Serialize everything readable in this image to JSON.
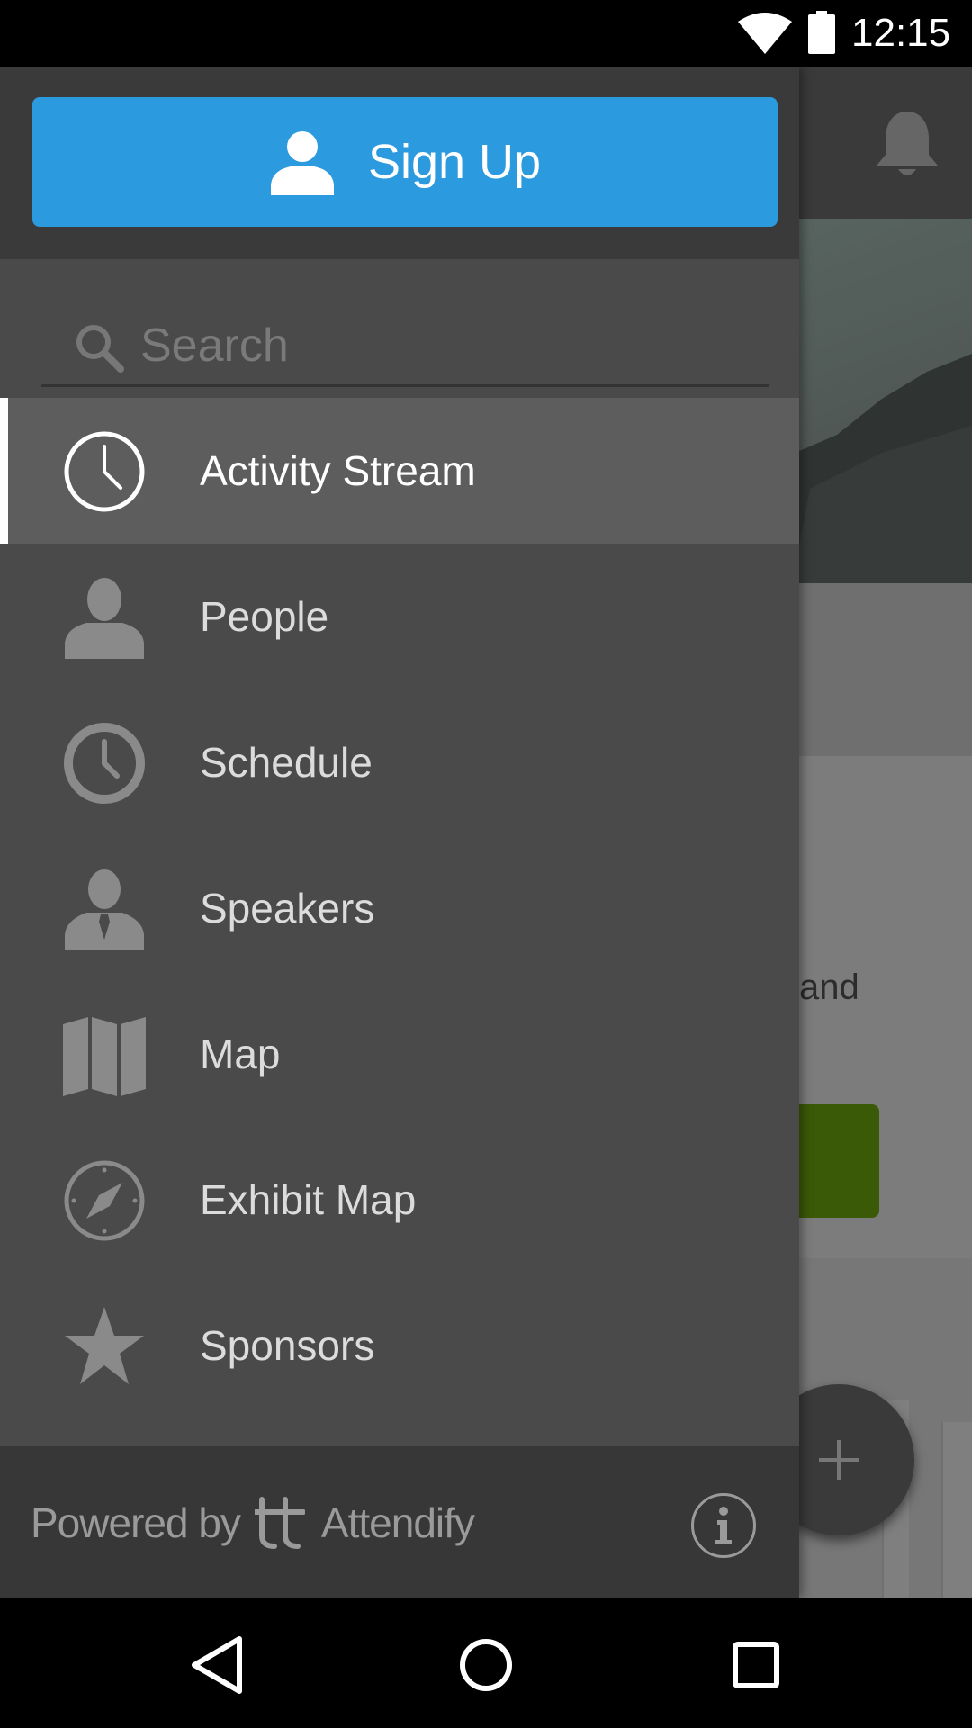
{
  "status_bar": {
    "time": "12:15",
    "icons": [
      "wifi-icon",
      "battery-icon"
    ]
  },
  "drawer": {
    "signup": {
      "label": "Sign Up",
      "icon": "user-icon"
    },
    "search": {
      "placeholder": "Search",
      "value": ""
    },
    "items": [
      {
        "label": "Activity Stream",
        "icon": "clock-outline-icon",
        "active": true
      },
      {
        "label": "People",
        "icon": "person-icon",
        "active": false
      },
      {
        "label": "Schedule",
        "icon": "clock-icon",
        "active": false
      },
      {
        "label": "Speakers",
        "icon": "speaker-person-icon",
        "active": false
      },
      {
        "label": "Map",
        "icon": "map-icon",
        "active": false
      },
      {
        "label": "Exhibit Map",
        "icon": "compass-icon",
        "active": false
      },
      {
        "label": "Sponsors",
        "icon": "star-icon",
        "active": false
      }
    ],
    "footer": {
      "powered_by": "Powered by",
      "brand": "Attendify",
      "info_icon": "info-icon"
    }
  },
  "background_app": {
    "card_text_fragment": "and"
  },
  "colors": {
    "primary_blue": "#2b9ade",
    "drawer_bg": "#4a4a4a",
    "drawer_header_bg": "#3a3a3a",
    "active_item_bg": "#5d5d5d",
    "green_button": "#3b5a07"
  },
  "navigation_bar": {
    "buttons": [
      "back-icon",
      "home-icon",
      "recents-icon"
    ]
  }
}
